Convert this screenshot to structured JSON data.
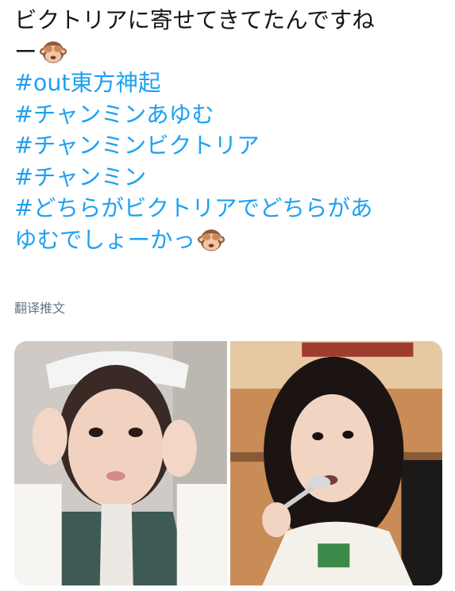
{
  "tweet": {
    "line1": "ビクトリアに寄せてきてたんですね",
    "line2": "ー",
    "hashtags": [
      "#out東方神起",
      "#チャンミンあゆむ",
      "#チャンミンビクトリア",
      "#チャンミン",
      "#どちらがビクトリアでどちらがあ"
    ],
    "line_last": "ゆむでしょーかっ"
  },
  "translate_label": "翻译推文",
  "icons": {
    "emoji": "see-no-evil-monkey-icon"
  },
  "colors": {
    "hashtag": "#1da1f2",
    "text": "#14171a",
    "muted": "#657786"
  }
}
